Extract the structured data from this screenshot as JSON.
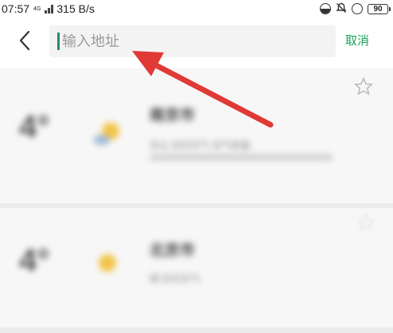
{
  "status_bar": {
    "time": "07:57",
    "network_type": "4G",
    "net_speed": "315 B/s",
    "battery": "90"
  },
  "header": {
    "back_label": "<",
    "search_placeholder": "输入地址",
    "search_value": "",
    "cancel_label": "取消"
  },
  "cards": [
    {
      "temperature": "4°",
      "city": "南京市",
      "detail": "多云 实时天气 空气质量",
      "weather_icon": "partly-cloudy-icon",
      "favorite_icon": "star-outline-icon"
    },
    {
      "temperature": "4°",
      "city": "北京市",
      "detail": "晴 实时天气",
      "weather_icon": "sun-icon",
      "favorite_icon": "star-outline-icon"
    }
  ],
  "colors": {
    "accent_green": "#1ba25a",
    "caret": "#2a8a68",
    "arrow_red": "#e03a36"
  }
}
